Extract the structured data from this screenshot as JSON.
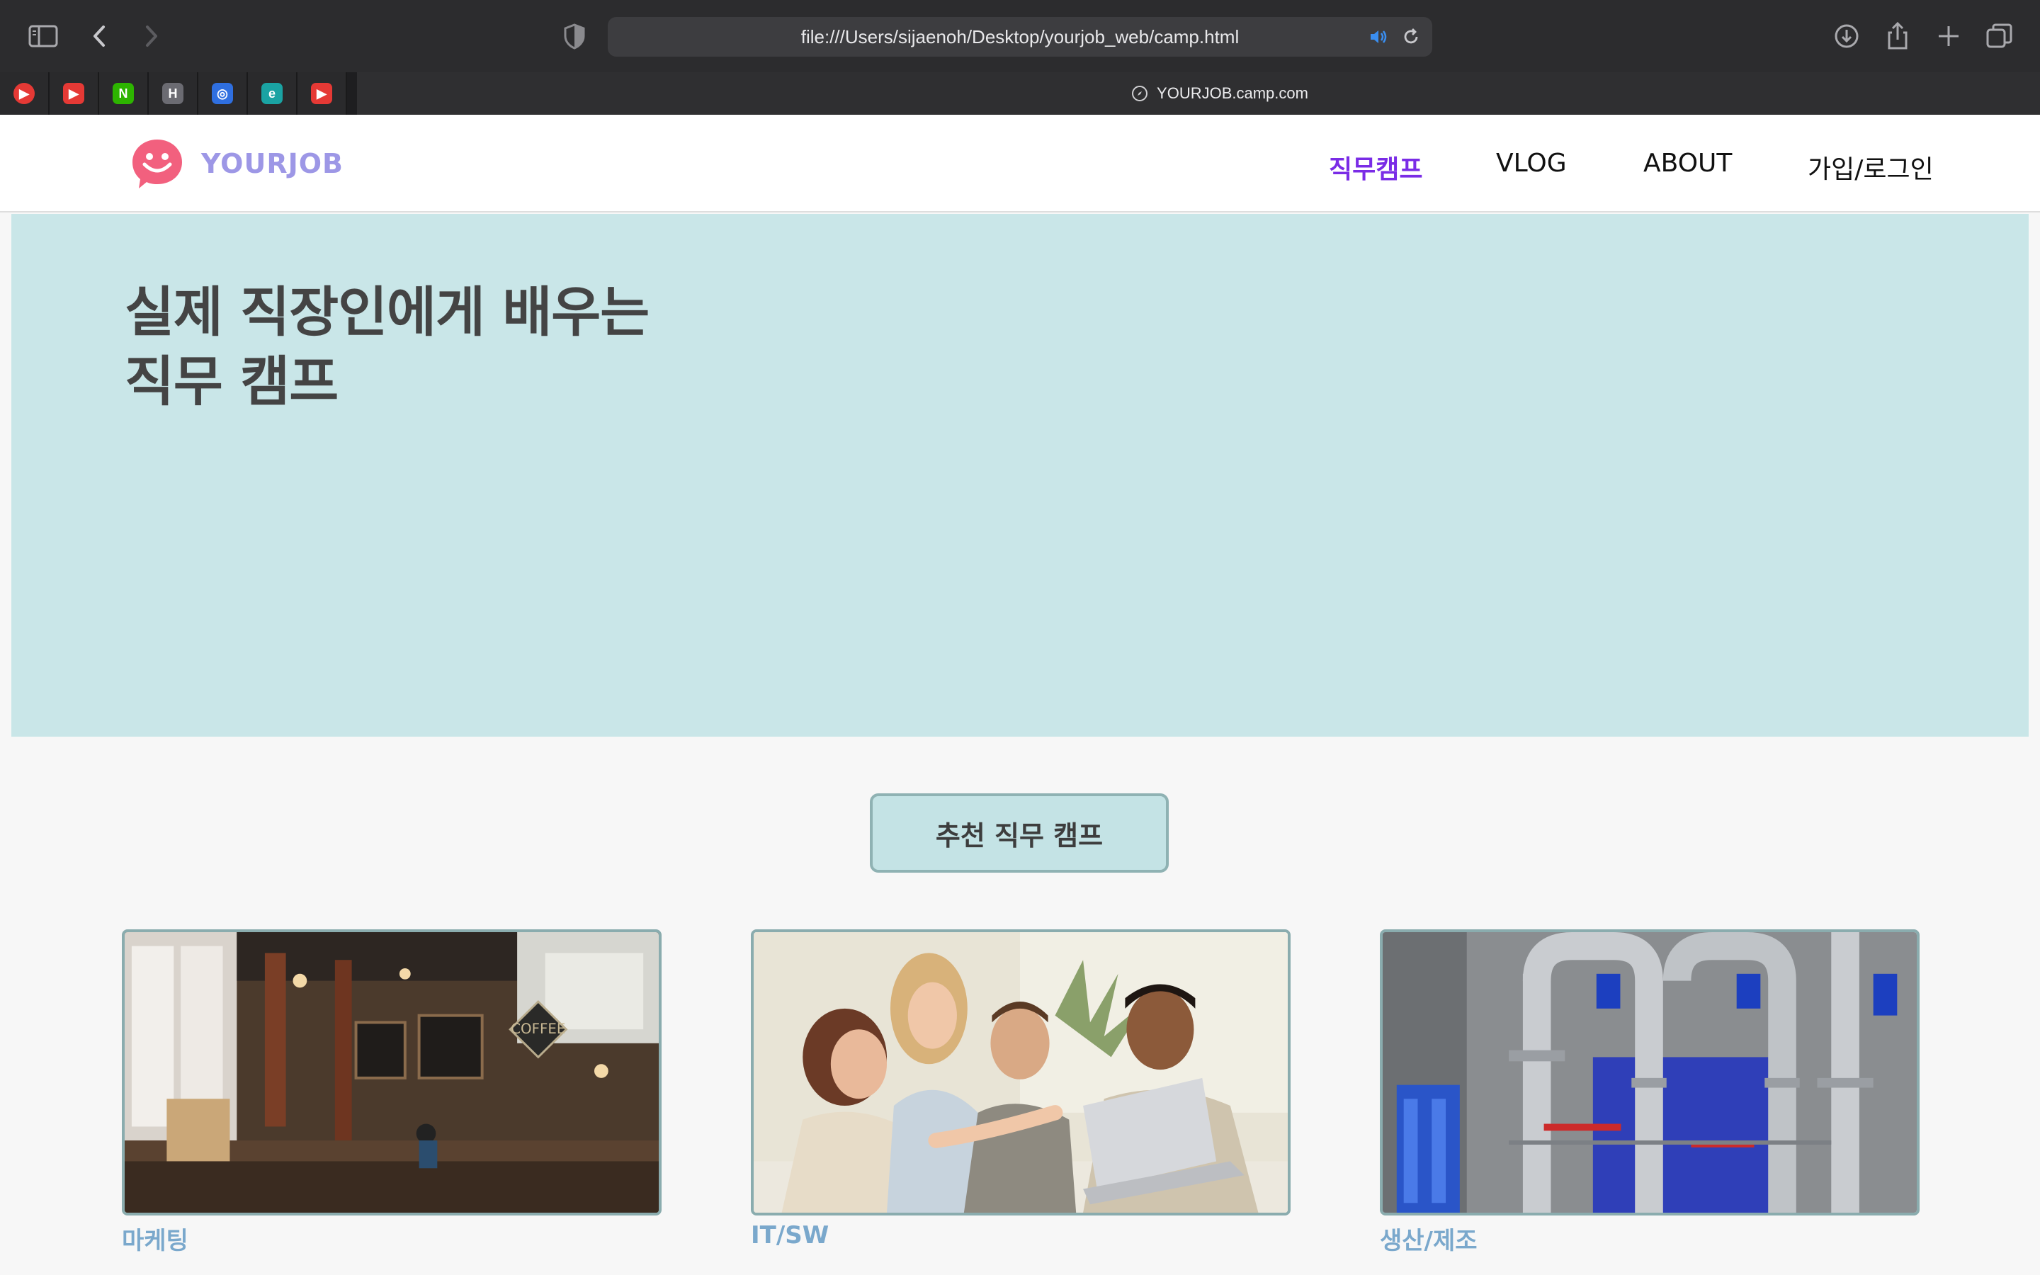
{
  "browser": {
    "url": "file:///Users/sijaenoh/Desktop/yourjob_web/camp.html",
    "active_tab_title": "YOURJOB.camp.com",
    "pinned_tabs": [
      {
        "icon": "youtube-music-icon",
        "color": "#e53935",
        "glyph": "▶"
      },
      {
        "icon": "youtube-icon",
        "color": "#e53935",
        "glyph": "▶"
      },
      {
        "icon": "naver-icon",
        "color": "#2db400",
        "glyph": "N"
      },
      {
        "icon": "h-app-icon",
        "color": "#6b6b72",
        "glyph": "H"
      },
      {
        "icon": "study-app-icon",
        "color": "#2f6fe0",
        "glyph": "◎"
      },
      {
        "icon": "edge-icon",
        "color": "#1aa3a3",
        "glyph": "e"
      },
      {
        "icon": "youtube-icon",
        "color": "#e53935",
        "glyph": "▶"
      }
    ]
  },
  "site": {
    "logo_text": "YOURJOB",
    "nav": {
      "camp": "직무캠프",
      "vlog": "VLOG",
      "about": "ABOUT",
      "login": "가입/로그인"
    },
    "hero": {
      "line1": "실제 직장인에게 배우는",
      "line2": "직무 캠프"
    },
    "section_button": "추천 직무 캠프",
    "cards": [
      {
        "label": "마케팅",
        "image": "coffee-shop-photo"
      },
      {
        "label": "IT/SW",
        "image": "team-meeting-photo"
      },
      {
        "label": "생산/제조",
        "image": "industrial-pipes-photo"
      }
    ],
    "colors": {
      "accent_nav": "#7a2ce6",
      "hero_bg": "#c9e6e8",
      "logo_text": "#9d97e6",
      "logo_mark": "#f2607e",
      "card_label": "#7aa8cc"
    }
  }
}
